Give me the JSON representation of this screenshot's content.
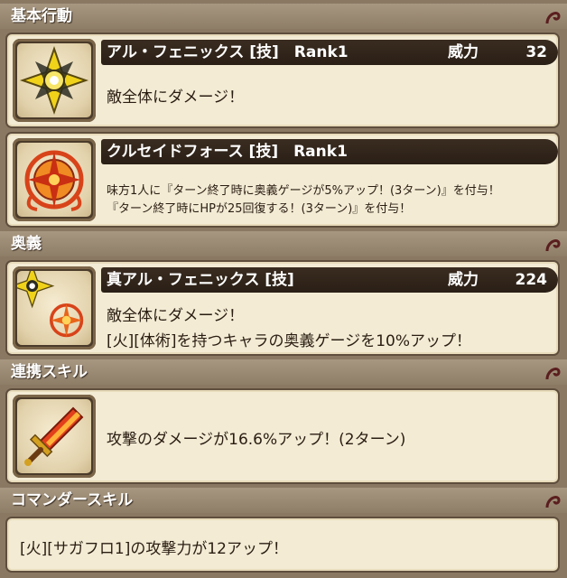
{
  "sections": {
    "basic": "基本行動",
    "ougi": "奥義",
    "link": "連携スキル",
    "commander": "コマンダースキル"
  },
  "basic_actions": [
    {
      "title": "アル・フェニックス [技]　Rank1",
      "power_label": "威力",
      "power_value": "32",
      "description": "敵全体にダメージ！",
      "icon": "shuriken-icon"
    },
    {
      "title": "クルセイドフォース [技]　Rank1",
      "line1": "味方1人に『ターン終了時に奥義ゲージが5%アップ！(3ターン)』を付与！",
      "line2": "『ターン終了時にHPが25回復する！(3ターン)』を付与！",
      "icon": "crusade-emblem-icon"
    }
  ],
  "ougi": {
    "title": "真アル・フェニックス [技]",
    "power_label": "威力",
    "power_value": "224",
    "line1": "敵全体にダメージ！",
    "line2": "[火][体術]を持つキャラの奥義ゲージを10%アップ！",
    "icon": "twin-shuriken-icon"
  },
  "link_skill": {
    "text": "攻撃のダメージが16.6%アップ！(2ターン)",
    "icon": "flame-sword-icon"
  },
  "commander_skill": {
    "text": "[火][サガフロ1]の攻撃力が12アップ！"
  },
  "colors": {
    "header_bg": "#9a8a74",
    "card_bg": "#f3ebd4",
    "titlebar_bg": "#2f2319",
    "text": "#2a1d12"
  }
}
